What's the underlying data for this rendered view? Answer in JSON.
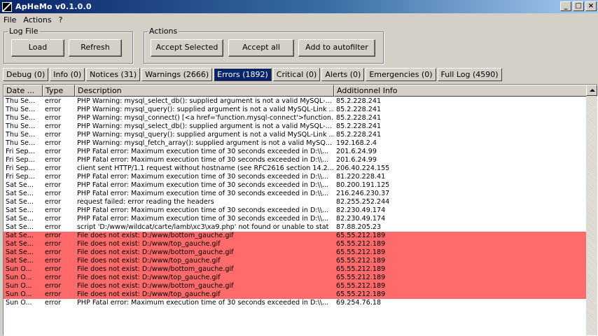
{
  "window": {
    "title": "ApHeMo v0.1.0.0",
    "min_label": "_",
    "max_label": "□",
    "close_label": "×"
  },
  "menu": [
    {
      "label": "File"
    },
    {
      "label": "Actions"
    },
    {
      "label": "?"
    }
  ],
  "log_file_group": {
    "label": "Log File",
    "load_label": "Load",
    "refresh_label": "Refresh"
  },
  "actions_group": {
    "label": "Actions",
    "accept_selected_label": "Accept Selected",
    "accept_all_label": "Accept all",
    "autofilter_label": "Add to autofilter"
  },
  "tabs": [
    {
      "label": "Debug (0)"
    },
    {
      "label": "Info (0)"
    },
    {
      "label": "Notices (31)"
    },
    {
      "label": "Warnings (2666)"
    },
    {
      "label": "Errors (1892)"
    },
    {
      "label": "Critical (0)"
    },
    {
      "label": "Alerts (0)"
    },
    {
      "label": "Emergencies (0)"
    },
    {
      "label": "Full Log (4590)"
    }
  ],
  "active_tab": "Errors (1892)",
  "columns": [
    "Date ...",
    "Type",
    "Description",
    "Additionnel Info"
  ],
  "highlight_color": "#ff6b6b",
  "rows": [
    {
      "date": "Thu Se...",
      "type": "error",
      "desc": "PHP Warning:  mysql_select_db(): supplied argument is not a valid MySQL-...",
      "info": "85.2.228.241",
      "hl": false
    },
    {
      "date": "Thu Se...",
      "type": "error",
      "desc": "PHP Warning:  mysql_query(): supplied argument is not a valid MySQL-Link ...",
      "info": "85.2.228.241",
      "hl": false
    },
    {
      "date": "Thu Se...",
      "type": "error",
      "desc": "PHP Warning:  mysql_connect() [<a href='function.mysql-connect'>function....",
      "info": "85.2.228.241",
      "hl": false
    },
    {
      "date": "Thu Se...",
      "type": "error",
      "desc": "PHP Warning:  mysql_select_db(): supplied argument is not a valid MySQL-...",
      "info": "85.2.228.241",
      "hl": false
    },
    {
      "date": "Thu Se...",
      "type": "error",
      "desc": "PHP Warning:  mysql_query(): supplied argument is not a valid MySQL-Link ...",
      "info": "85.2.228.241",
      "hl": false
    },
    {
      "date": "Thu Se...",
      "type": "error",
      "desc": "PHP Warning:  mysql_fetch_array(): supplied argument is not a valid MySQ...",
      "info": "192.168.2.4",
      "hl": false
    },
    {
      "date": "Fri Sep...",
      "type": "error",
      "desc": "PHP Fatal error:  Maximum execution time of 30 seconds exceeded in D:\\\\...",
      "info": "201.6.24.99",
      "hl": false
    },
    {
      "date": "Fri Sep...",
      "type": "error",
      "desc": "PHP Fatal error:  Maximum execution time of 30 seconds exceeded in D:\\\\...",
      "info": "201.6.24.99",
      "hl": false
    },
    {
      "date": "Fri Sep...",
      "type": "error",
      "desc": "client sent HTTP/1.1 request without hostname (see RFC2616 section 14.2...",
      "info": "206.40.224.155",
      "hl": false
    },
    {
      "date": "Fri Sep...",
      "type": "error",
      "desc": "PHP Fatal error:  Maximum execution time of 30 seconds exceeded in D:\\\\...",
      "info": "81.220.228.41",
      "hl": false
    },
    {
      "date": "Sat Se...",
      "type": "error",
      "desc": "PHP Fatal error:  Maximum execution time of 30 seconds exceeded in D:\\\\...",
      "info": "80.200.191.125",
      "hl": false
    },
    {
      "date": "Sat Se...",
      "type": "error",
      "desc": "PHP Fatal error:  Maximum execution time of 30 seconds exceeded in D:\\\\...",
      "info": "216.246.230.37",
      "hl": false
    },
    {
      "date": "Sat Se...",
      "type": "error",
      "desc": "request failed: error reading the headers",
      "info": "82.255.252.244",
      "hl": false
    },
    {
      "date": "Sat Se...",
      "type": "error",
      "desc": "PHP Fatal error:  Maximum execution time of 30 seconds exceeded in D:\\\\...",
      "info": "82.230.49.174",
      "hl": false
    },
    {
      "date": "Sat Se...",
      "type": "error",
      "desc": "PHP Fatal error:  Maximum execution time of 30 seconds exceeded in D:\\\\...",
      "info": "82.230.49.174",
      "hl": false
    },
    {
      "date": "Sat Se...",
      "type": "error",
      "desc": "script 'D:/www/wildcat/carte/lamb\\xc3\\xa9.php' not found or unable to stat",
      "info": "87.88.205.23",
      "hl": false
    },
    {
      "date": "Sat Se...",
      "type": "error",
      "desc": "File does not exist: D:/www/bottom_gauche.gif",
      "info": "65.55.212.189",
      "hl": true
    },
    {
      "date": "Sat Se...",
      "type": "error",
      "desc": "File does not exist: D:/www/top_gauche.gif",
      "info": "65.55.212.189",
      "hl": true
    },
    {
      "date": "Sat Se...",
      "type": "error",
      "desc": "File does not exist: D:/www/bottom_gauche.gif",
      "info": "65.55.212.189",
      "hl": true
    },
    {
      "date": "Sat Se...",
      "type": "error",
      "desc": "File does not exist: D:/www/top_gauche.gif",
      "info": "65.55.212.189",
      "hl": true
    },
    {
      "date": "Sun O...",
      "type": "error",
      "desc": "File does not exist: D:/www/bottom_gauche.gif",
      "info": "65.55.212.189",
      "hl": true
    },
    {
      "date": "Sun O...",
      "type": "error",
      "desc": "File does not exist: D:/www/top_gauche.gif",
      "info": "65.55.212.189",
      "hl": true
    },
    {
      "date": "Sun O...",
      "type": "error",
      "desc": "File does not exist: D:/www/bottom_gauche.gif",
      "info": "65.55.212.189",
      "hl": true
    },
    {
      "date": "Sun O...",
      "type": "error",
      "desc": "File does not exist: D:/www/top_gauche.gif",
      "info": "65.55.212.189",
      "hl": true
    },
    {
      "date": "Sun O...",
      "type": "error",
      "desc": "PHP Fatal error:  Maximum execution time of 30 seconds exceeded in D:\\\\...",
      "info": "69.254.76.18",
      "hl": false
    }
  ]
}
